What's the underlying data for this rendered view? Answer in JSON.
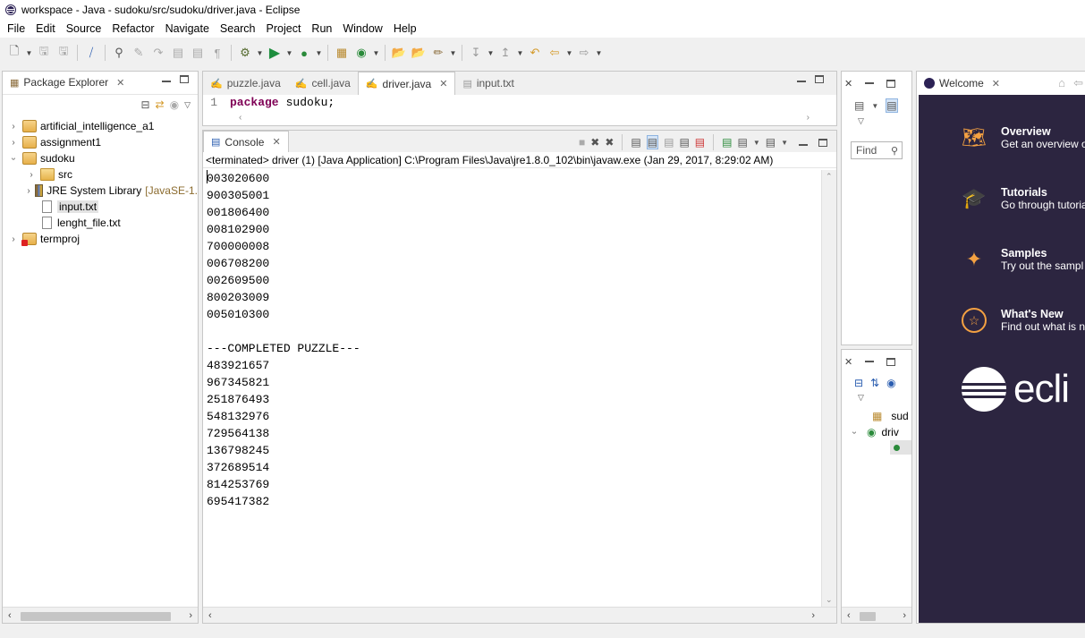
{
  "window": {
    "title": "workspace - Java - sudoku/src/sudoku/driver.java - Eclipse"
  },
  "menu": [
    "File",
    "Edit",
    "Source",
    "Refactor",
    "Navigate",
    "Search",
    "Project",
    "Run",
    "Window",
    "Help"
  ],
  "package_explorer": {
    "tab_label": "Package Explorer",
    "items": [
      {
        "label": "artificial_intelligence_a1"
      },
      {
        "label": "assignment1"
      },
      {
        "label": "sudoku"
      },
      {
        "label": "src"
      },
      {
        "label": "JRE System Library",
        "decoration": "[JavaSE-1."
      },
      {
        "label": "input.txt"
      },
      {
        "label": "lenght_file.txt"
      },
      {
        "label": "termproj"
      }
    ]
  },
  "editor": {
    "tabs": [
      {
        "label": "puzzle.java"
      },
      {
        "label": "cell.java"
      },
      {
        "label": "driver.java"
      },
      {
        "label": "input.txt"
      }
    ],
    "line_number": "1",
    "keyword": "package",
    "code_rest": "sudoku;"
  },
  "console": {
    "tab_label": "Console",
    "header": "<terminated> driver (1) [Java Application] C:\\Program Files\\Java\\jre1.8.0_102\\bin\\javaw.exe (Jan 29, 2017, 8:29:02 AM)",
    "output": "003020600\n900305001\n001806400\n008102900\n700000008\n006708200\n002609500\n800203009\n005010300\n\n---COMPLETED PUZZLE---\n483921657\n967345821\n251876493\n548132976\n729564138\n136798245\n372689514\n814253769\n695417382"
  },
  "right_pane": {
    "find_placeholder": "Find",
    "outline_items": [
      {
        "label": "sud"
      },
      {
        "label": "driv"
      }
    ]
  },
  "welcome": {
    "tab_label": "Welcome",
    "items": [
      {
        "title": "Overview",
        "desc": "Get an overview o"
      },
      {
        "title": "Tutorials",
        "desc": "Go through tutoria"
      },
      {
        "title": "Samples",
        "desc": "Try out the sampl"
      },
      {
        "title": "What's New",
        "desc": "Find out what is n"
      }
    ],
    "logo_text": "ecli"
  },
  "colors": {
    "welcome_bg": "#2c2540",
    "welcome_accent": "#f4a142",
    "keyword": "#7f0055"
  }
}
